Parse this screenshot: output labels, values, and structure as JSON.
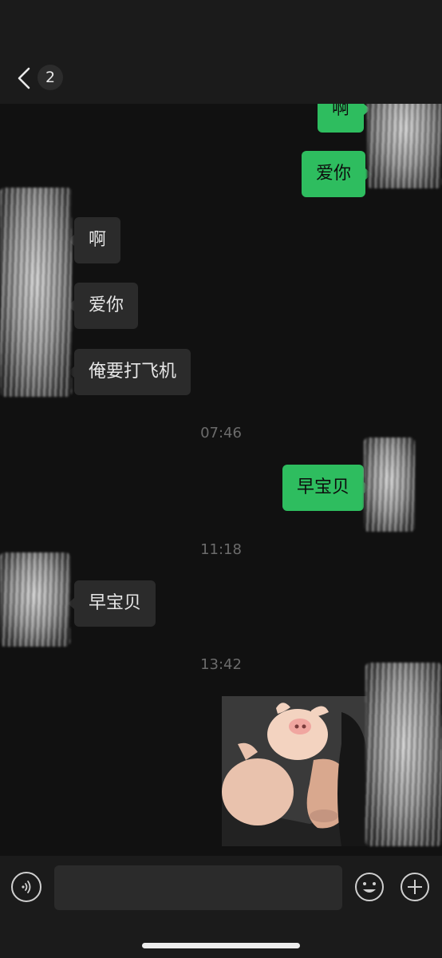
{
  "header": {
    "back_icon": "chevron-left-icon",
    "unread_count": "2"
  },
  "messages": [
    {
      "side": "sent",
      "text": "啊"
    },
    {
      "side": "sent",
      "text": "爱你"
    },
    {
      "side": "received",
      "text": "啊"
    },
    {
      "side": "received",
      "text": "爱你"
    },
    {
      "side": "received",
      "text": "俺要打飞机"
    },
    {
      "type": "time",
      "text": "07:46"
    },
    {
      "side": "sent",
      "text": "早宝贝"
    },
    {
      "type": "time",
      "text": "11:18"
    },
    {
      "side": "received",
      "text": "早宝贝"
    },
    {
      "type": "time",
      "text": "13:42"
    },
    {
      "side": "sent",
      "type": "image",
      "content": "pig-toy-photo"
    }
  ],
  "input_bar": {
    "voice_icon": "voice-icon",
    "emoji_icon": "emoji-icon",
    "plus_icon": "plus-icon",
    "input_value": ""
  },
  "colors": {
    "sent_bubble": "#2ebd5f",
    "received_bubble": "#2b2b2b",
    "background": "#111111",
    "bar": "#1b1b1b"
  }
}
